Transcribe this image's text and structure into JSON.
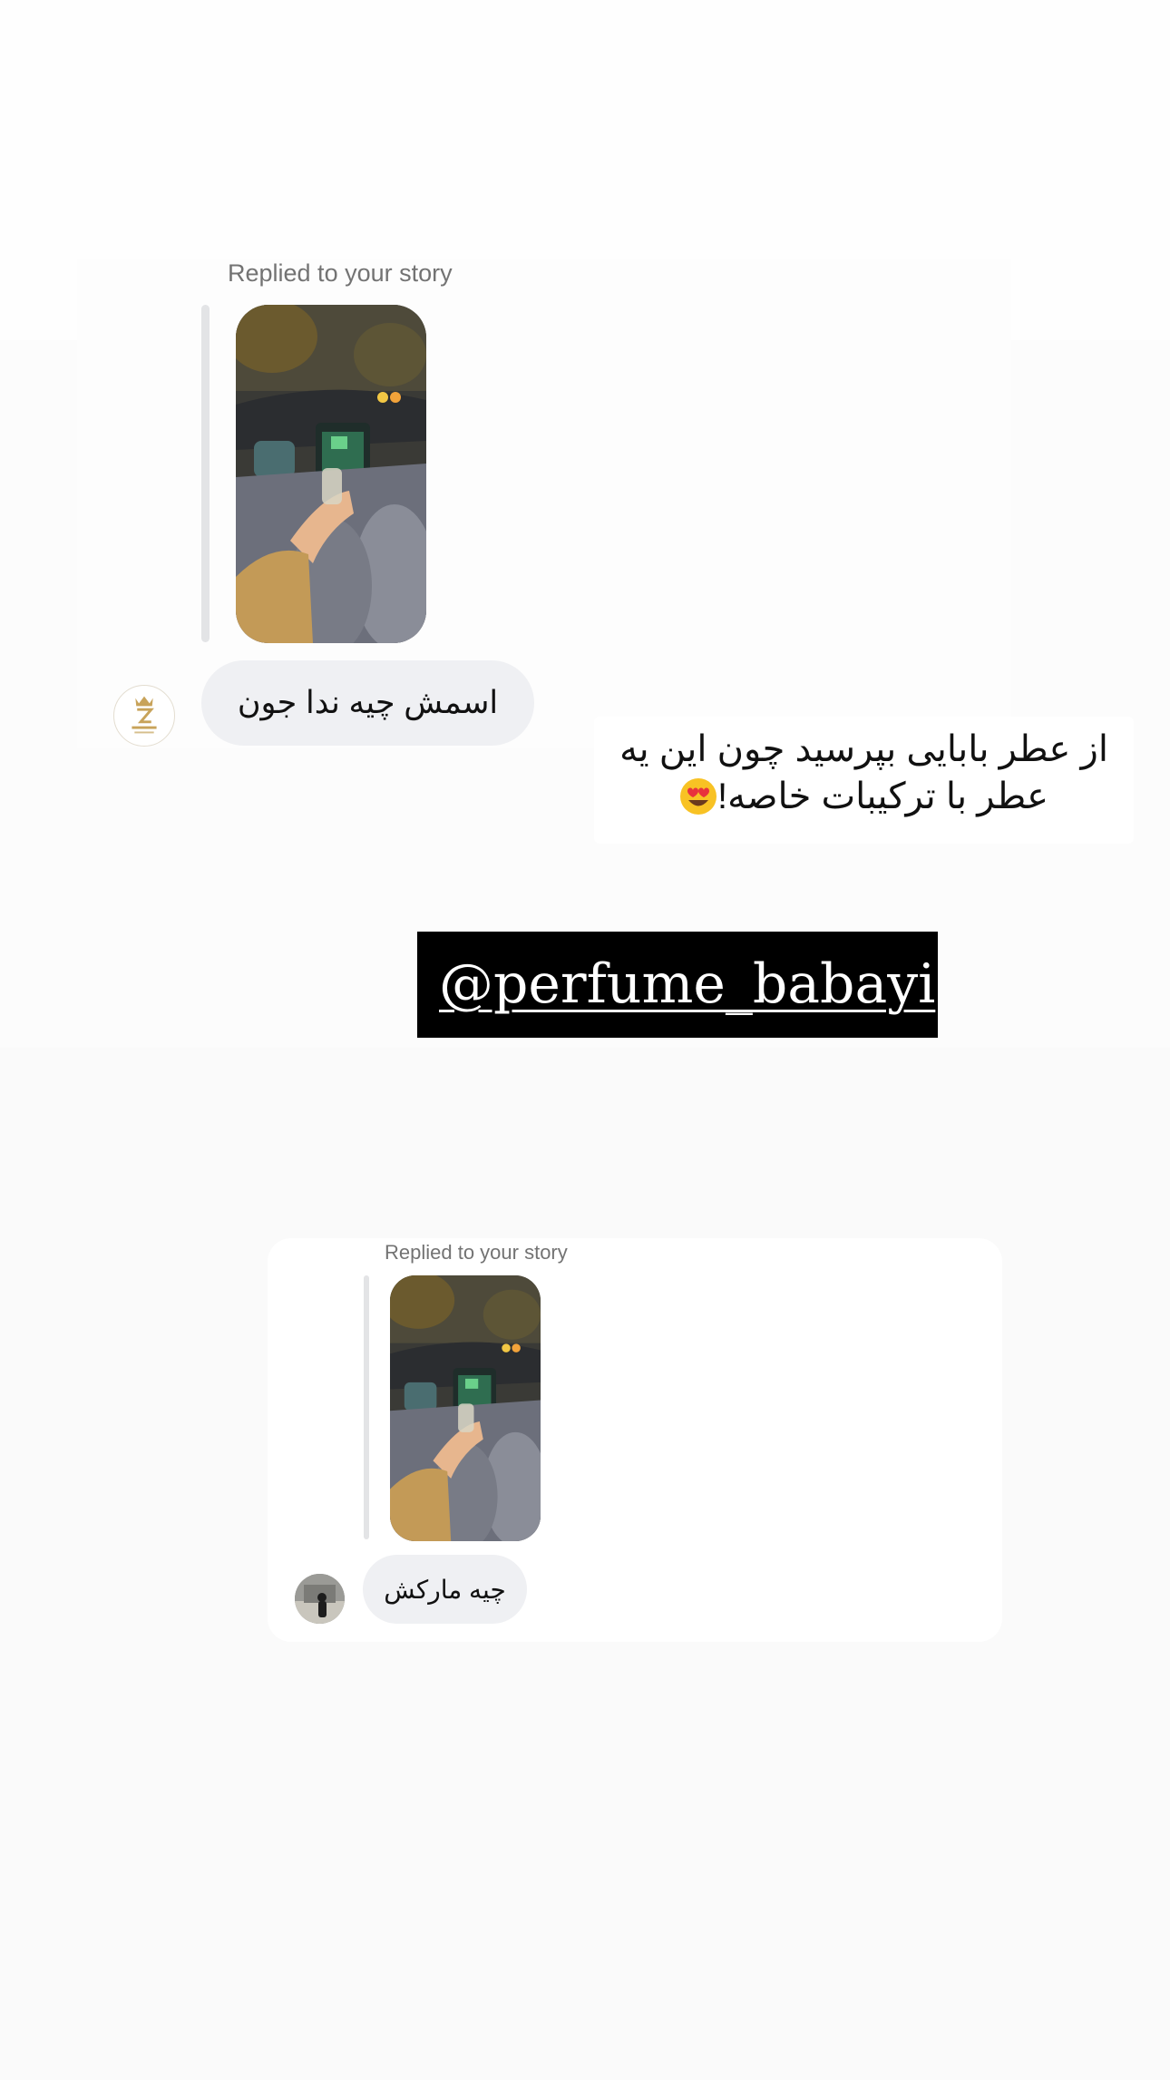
{
  "conversation_1": {
    "replied_label": "Replied to your story",
    "message": "اسمش چیه ندا  جون"
  },
  "caption": {
    "line1": "از عطر بابایی بپرسید چون این یه",
    "line2": "عطر با ترکیبات خاصه!",
    "emoji": "heart-eyes-emoji"
  },
  "mention": {
    "handle": "@perfume_babayi"
  },
  "conversation_2": {
    "replied_label": "Replied to your story",
    "message": "چیه مارکش"
  },
  "icons": [
    "zartaj-logo-avatar",
    "user-photo-avatar",
    "story-thumbnail",
    "heart-eyes-emoji"
  ],
  "colors": {
    "page_background": "#fafafa",
    "bubble": "#eff0f3",
    "replied_text": "#737373",
    "mention_background": "#000000",
    "mention_text": "#ffffff"
  }
}
